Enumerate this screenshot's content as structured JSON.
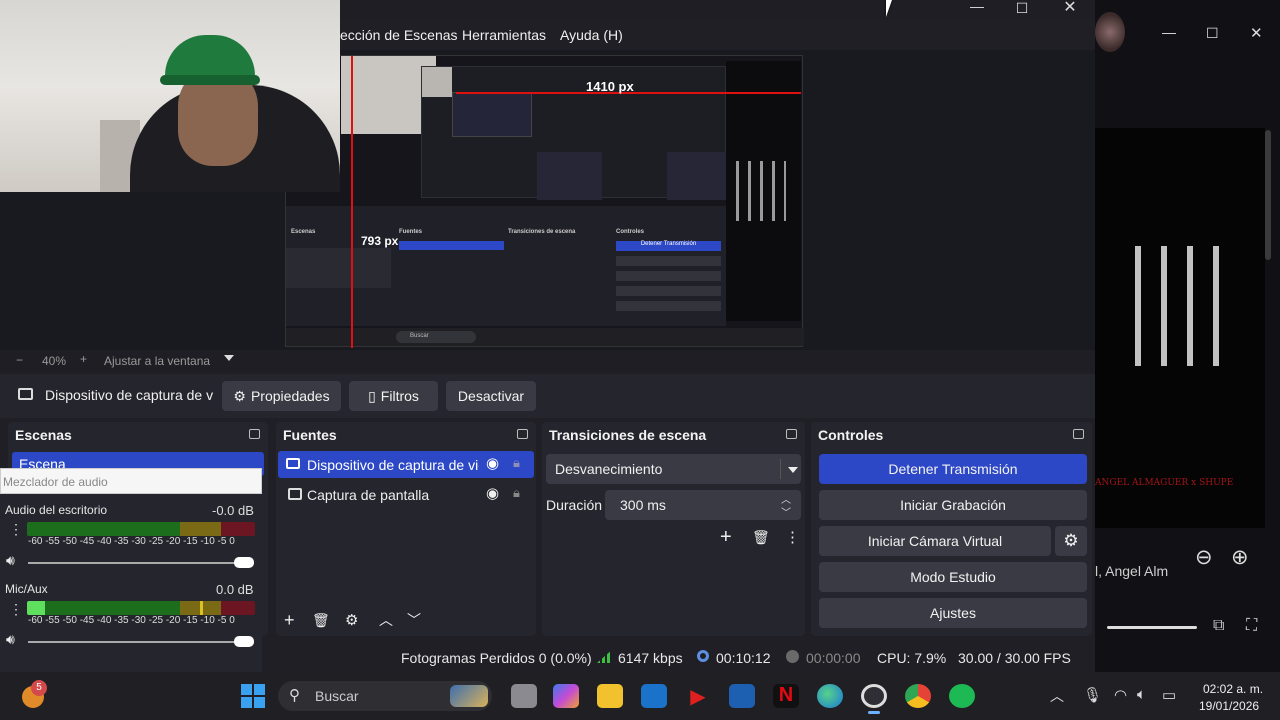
{
  "menu": {
    "items": [
      "ección de Escenas",
      "Herramientas",
      "Ayuda (H)"
    ]
  },
  "preview": {
    "measure_h": "1410 px",
    "measure_v": "793 px",
    "inner_scenes": "Escenas",
    "inner_sources": "Fuentes",
    "inner_transitions": "Transiciones de escena",
    "inner_controls": "Controles",
    "inner_stop": "Detener Transmisión",
    "inner_search": "Buscar"
  },
  "zoom": {
    "minus": "−",
    "value": "40%",
    "plus": "+",
    "fit": "Ajustar a la ventana"
  },
  "source_toolbar": {
    "source_name": "Dispositivo de captura de v",
    "properties": "Propiedades",
    "filters": "Filtros",
    "deactivate": "Desactivar"
  },
  "scenes": {
    "title": "Escenas",
    "items": [
      "Escena"
    ]
  },
  "sources": {
    "title": "Fuentes",
    "items": [
      "Dispositivo de captura de vic",
      "Captura de pantalla"
    ]
  },
  "transitions": {
    "title": "Transiciones de escena",
    "selected": "Desvanecimiento",
    "duration_label": "Duración",
    "duration_value": "300 ms"
  },
  "controls": {
    "title": "Controles",
    "stop_stream": "Detener Transmisión",
    "start_recording": "Iniciar Grabación",
    "start_virtual_cam": "Iniciar Cámara Virtual",
    "studio_mode": "Modo Estudio",
    "settings": "Ajustes"
  },
  "mixer": {
    "title": "Mezclador de audio",
    "scale": "-60 -55 -50 -45 -40 -35 -30 -25 -20 -15 -10 -5 0",
    "channels": [
      {
        "name": "Audio del escritorio",
        "db": "-0.0 dB",
        "level": 0
      },
      {
        "name": "Mic/Aux",
        "db": "0.0 dB",
        "level": 0.07
      }
    ]
  },
  "status": {
    "dropped": "Fotogramas Perdidos 0 (0.0%)",
    "bitrate": "6147 kbps",
    "stream_time": "00:10:12",
    "rec_time": "00:00:00",
    "cpu": "CPU: 7.9%",
    "fps": "30.00 / 30.00 FPS"
  },
  "right_window": {
    "text": "l, Angel Alm",
    "album_text": "ANGEL ALMAGUER x SHUPE"
  },
  "taskbar": {
    "search_placeholder": "Buscar",
    "time": "02:02 a. m.",
    "date": "19/01/2026",
    "badge": "5"
  },
  "colors": {
    "accent": "#2c48c6",
    "selection": "#2c48c6",
    "bg": "#1f1f25",
    "dock": "#25252d",
    "button": "#3a3a44",
    "marker_red": "#e01010"
  }
}
